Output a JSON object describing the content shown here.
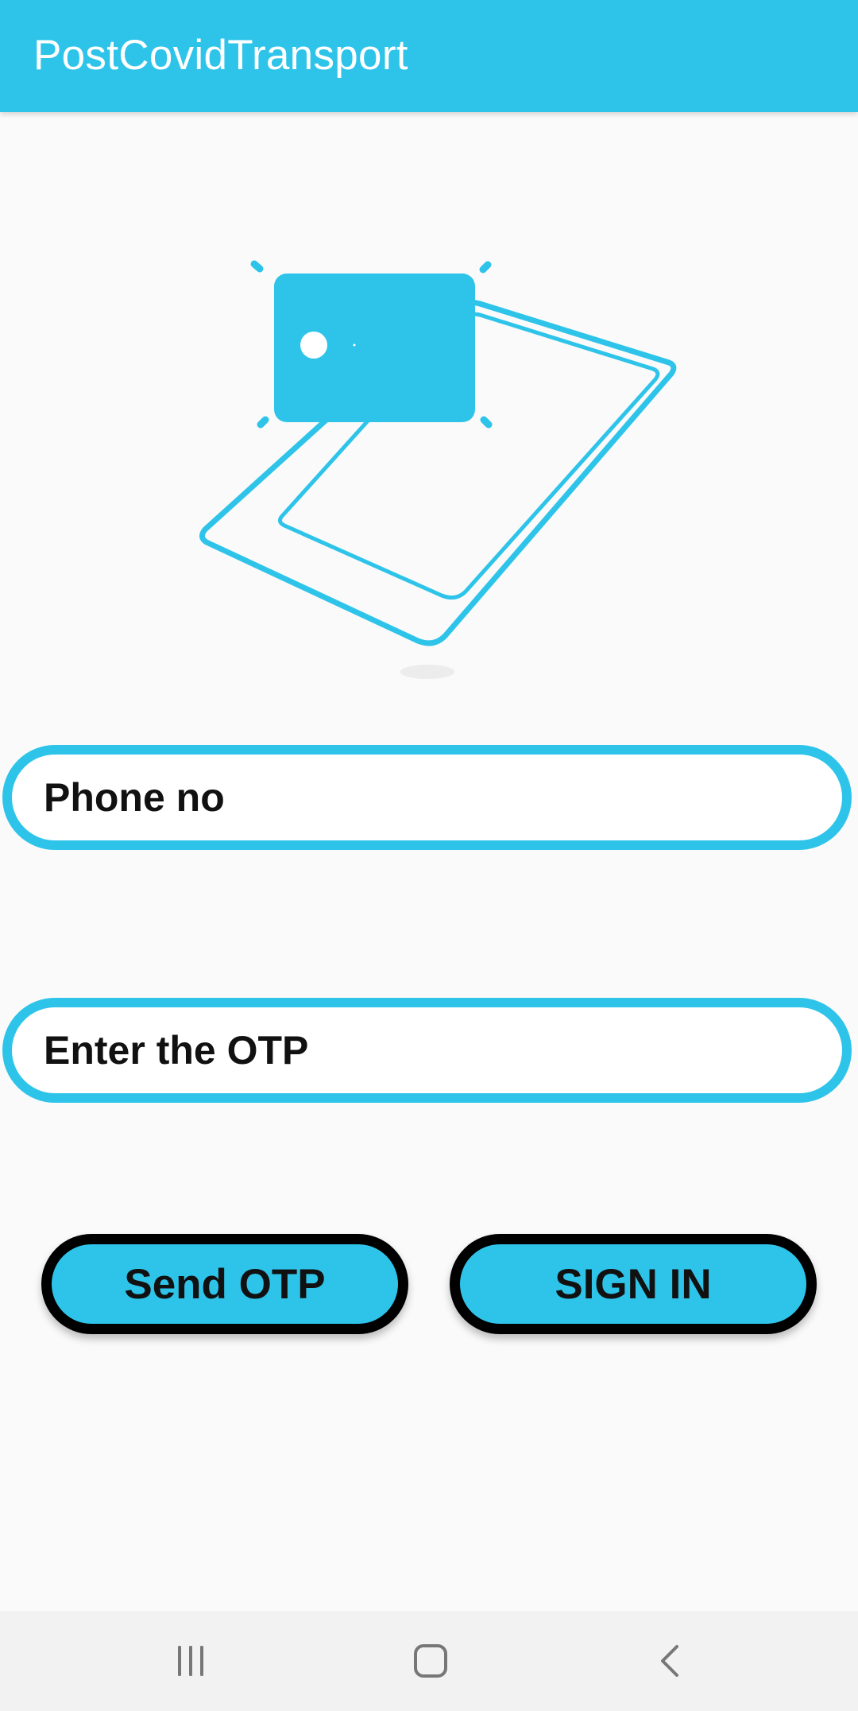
{
  "app_bar": {
    "title": "PostCovidTransport",
    "background": "#2ec4ea"
  },
  "illustration": {
    "icon": "phone-with-card-icon",
    "accent": "#2ec4ea"
  },
  "form": {
    "phone_placeholder": "Phone no",
    "otp_placeholder": "Enter the OTP"
  },
  "buttons": {
    "send_otp_label": "Send OTP",
    "sign_in_label": "SIGN IN"
  },
  "nav_bar": {
    "recents_icon": "recent-apps-icon",
    "home_icon": "home-icon",
    "back_icon": "back-icon"
  }
}
